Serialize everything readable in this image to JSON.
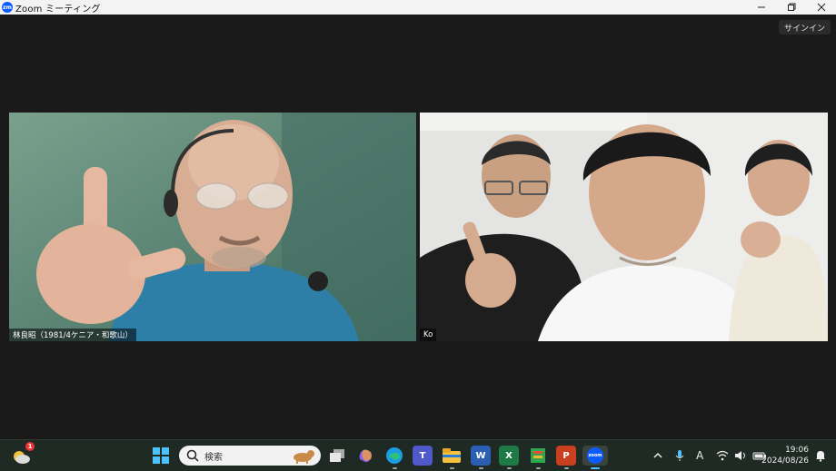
{
  "window": {
    "app_logo": "zm",
    "title": "Zoom ミーティング",
    "controls": [
      "minimize",
      "restore",
      "close"
    ]
  },
  "toolbar": {
    "signin_label": "サインイン"
  },
  "participants": [
    {
      "name": "林良昭（1981/4ケニア・和歌山）"
    },
    {
      "name": "Ko"
    }
  ],
  "taskbar": {
    "weather_badge": "1",
    "search_placeholder": "検索",
    "apps": [
      "start-icon",
      "task-view-icon",
      "copilot-icon",
      "edge-icon",
      "teams-icon",
      "file-explorer-icon",
      "word-icon",
      "excel-icon",
      "sheets-icon",
      "powerpoint-icon",
      "zoom-icon"
    ],
    "app_letters": {
      "word": "W",
      "excel": "X",
      "powerpoint": "P",
      "zoom": "zoom"
    },
    "tray": {
      "ime": "A"
    },
    "clock_time": "19:06",
    "clock_date": "2024/08/26"
  }
}
